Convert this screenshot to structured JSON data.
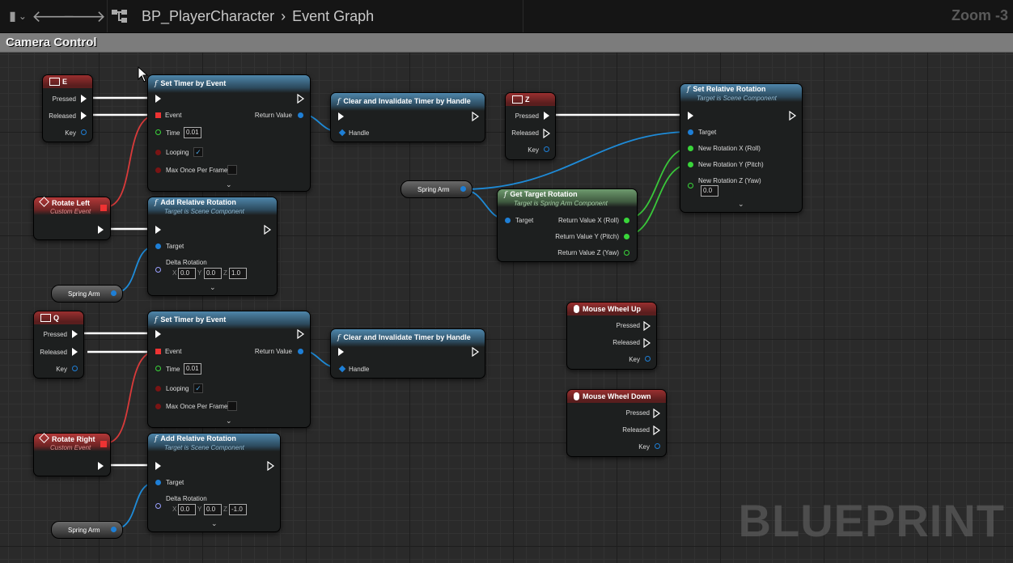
{
  "toolbar": {
    "title": "BP_PlayerCharacter",
    "subtitle": "Event Graph",
    "zoom": "Zoom -3"
  },
  "comment": {
    "title": "Camera Control"
  },
  "watermark": "BLUEPRINT",
  "key_e": {
    "title": "E",
    "pressed": "Pressed",
    "released": "Released",
    "key": "Key"
  },
  "key_q": {
    "title": "Q",
    "pressed": "Pressed",
    "released": "Released",
    "key": "Key"
  },
  "key_z": {
    "title": "Z",
    "pressed": "Pressed",
    "released": "Released",
    "key": "Key"
  },
  "timer1": {
    "title": "Set Timer by Event",
    "event": "Event",
    "return": "Return Value",
    "time": "Time",
    "time_val": "0.01",
    "looping": "Looping",
    "max_once": "Max Once Per Frame"
  },
  "timer2": {
    "title": "Set Timer by Event",
    "event": "Event",
    "return": "Return Value",
    "time": "Time",
    "time_val": "0.01",
    "looping": "Looping",
    "max_once": "Max Once Per Frame"
  },
  "clear1": {
    "title": "Clear and Invalidate Timer by Handle",
    "handle": "Handle"
  },
  "clear2": {
    "title": "Clear and Invalidate Timer by Handle",
    "handle": "Handle"
  },
  "rotate_left": {
    "title": "Rotate Left",
    "sub": "Custom Event"
  },
  "rotate_right": {
    "title": "Rotate Right",
    "sub": "Custom Event"
  },
  "add_rot1": {
    "title": "Add Relative Rotation",
    "sub": "Target is Scene Component",
    "target": "Target",
    "delta": "Delta Rotation",
    "x": "0.0",
    "y": "0.0",
    "z": "1.0"
  },
  "add_rot2": {
    "title": "Add Relative Rotation",
    "sub": "Target is Scene Component",
    "target": "Target",
    "delta": "Delta Rotation",
    "x": "0.0",
    "y": "0.0",
    "z": "-1.0"
  },
  "spring_arm_label": "Spring Arm",
  "get_rot": {
    "title": "Get Target Rotation",
    "sub": "Target is Spring Arm Component",
    "target": "Target",
    "rx": "Return Value X (Roll)",
    "ry": "Return Value Y (Pitch)",
    "rz": "Return Value Z (Yaw)"
  },
  "set_rot": {
    "title": "Set Relative Rotation",
    "sub": "Target is Scene Component",
    "target": "Target",
    "nx": "New Rotation X (Roll)",
    "ny": "New Rotation Y (Pitch)",
    "nz": "New Rotation Z (Yaw)",
    "nz_val": "0.0"
  },
  "wheel_up": {
    "title": "Mouse Wheel Up",
    "pressed": "Pressed",
    "released": "Released",
    "key": "Key"
  },
  "wheel_down": {
    "title": "Mouse Wheel Down",
    "pressed": "Pressed",
    "released": "Released",
    "key": "Key"
  },
  "colors": {
    "exec": "#ffffff",
    "object": "#1e7fd6",
    "float": "#39d63a",
    "event": "#e33333"
  }
}
